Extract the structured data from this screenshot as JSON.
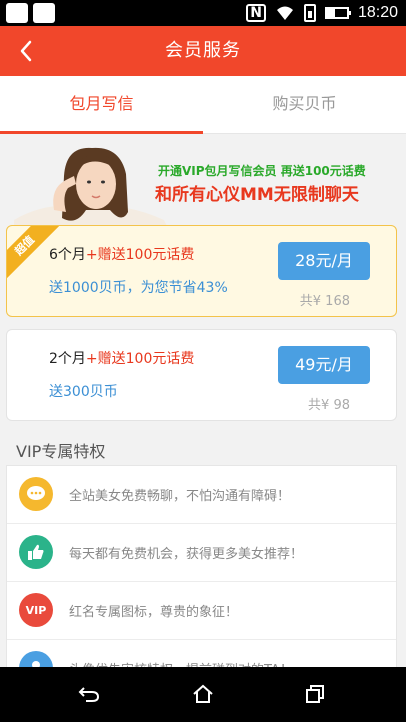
{
  "status_bar": {
    "time": "18:20",
    "nfc_label": "N",
    "icons": [
      "notification-box-icon",
      "notification-box-icon",
      "nfc-icon",
      "wifi-icon",
      "sim-icon",
      "battery-icon"
    ]
  },
  "header": {
    "title": "会员服务",
    "back_icon": "chevron-left-icon"
  },
  "tabs": [
    {
      "label": "包月写信",
      "active": true
    },
    {
      "label": "购买贝币",
      "active": false
    }
  ],
  "banner": {
    "line1": "开通VIP包月写信会员 再送100元话费",
    "line2": "和所有心仪MM无限制聊天"
  },
  "plans": [
    {
      "badge": "超值",
      "months": "6个月",
      "bonus": "+赠送100元话费",
      "desc": "送1000贝币，为您节省43%",
      "price": "28元/月",
      "total": "共¥ 168"
    },
    {
      "badge": "",
      "months": "2个月",
      "bonus": "+赠送100元话费",
      "desc": "送300贝币",
      "price": "49元/月",
      "total": "共¥ 98"
    }
  ],
  "perks_title": "VIP专属特权",
  "perks": [
    {
      "text": "全站美女免费畅聊，不怕沟通有障碍！",
      "icon": "chat-bubble-icon",
      "color": "#f5b82e"
    },
    {
      "text": "每天都有免费机会，获得更多美女推荐！",
      "icon": "thumbs-up-icon",
      "color": "#2bb38a"
    },
    {
      "text": "红名专属图标，尊贵的象征！",
      "icon": "vip-badge-icon",
      "icon_label": "VIP",
      "color": "#e94a3c"
    },
    {
      "text": "头像优先审核特权，提前碰到对的TA！",
      "icon": "avatar-icon",
      "color": "#4a9fe2"
    }
  ],
  "colors": {
    "accent": "#f1472b",
    "price_button": "#4a9fe2",
    "highlight_card_bg": "#fff9e2",
    "badge": "#f2b020"
  },
  "nav_bar": {
    "icons": [
      "back-nav-icon",
      "home-nav-icon",
      "recents-nav-icon"
    ]
  }
}
